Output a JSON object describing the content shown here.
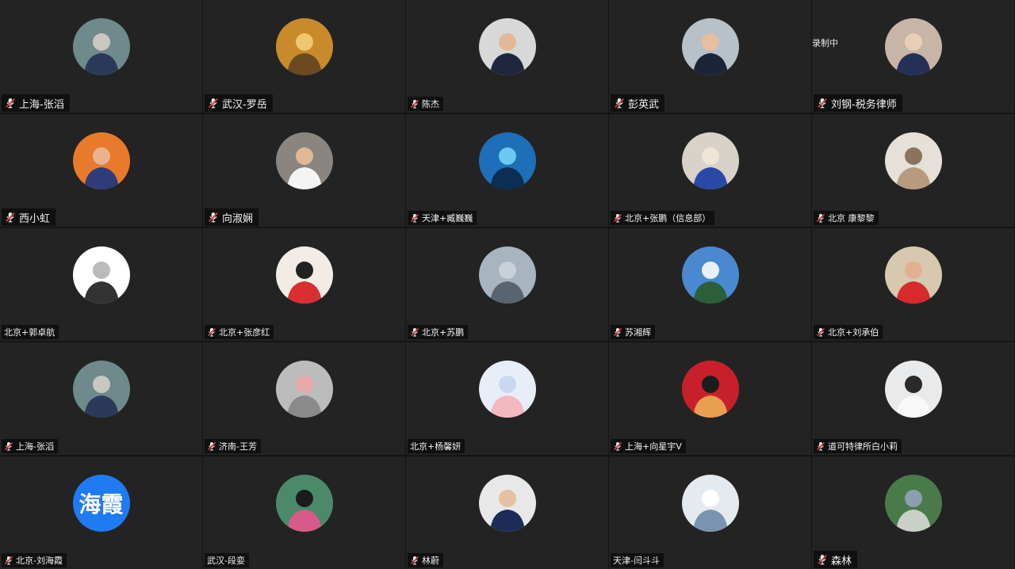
{
  "colors": {
    "tile_bg": "#232323",
    "mic_red": "#d93b3b",
    "text_avatar_bg": "#1f7bf2"
  },
  "overlay_text": "录制中",
  "participants": [
    {
      "name": "上海-张滔",
      "muted": true,
      "avatar": "photo",
      "colors": [
        "#6f8a8c",
        "#2c3a5a",
        "#c9c7bf"
      ]
    },
    {
      "name": "武汉-罗岳",
      "muted": true,
      "avatar": "photo",
      "colors": [
        "#c98a2c",
        "#6b4a22",
        "#f0c66e"
      ]
    },
    {
      "name": "陈杰",
      "muted": true,
      "avatar": "photo",
      "colors": [
        "#d8d8d8",
        "#1f2740",
        "#e3b897"
      ]
    },
    {
      "name": "彭英武",
      "muted": true,
      "avatar": "photo",
      "colors": [
        "#b8c0c8",
        "#1c2438",
        "#e6bf9f"
      ]
    },
    {
      "name": "刘钢-税务律师",
      "muted": true,
      "avatar": "photo",
      "colors": [
        "#c9b4a8",
        "#243058",
        "#e8d0b8"
      ]
    },
    {
      "name": "西小虹",
      "muted": true,
      "avatar": "photo",
      "colors": [
        "#e87a2c",
        "#2e3d7a",
        "#e8b48f"
      ]
    },
    {
      "name": "向淑娴",
      "muted": true,
      "avatar": "photo",
      "colors": [
        "#8a8580",
        "#f4f4f4",
        "#e0b898"
      ]
    },
    {
      "name": "天津+臧巍巍",
      "muted": true,
      "avatar": "photo",
      "colors": [
        "#1e6fb8",
        "#0c2e55",
        "#6cc8f0"
      ]
    },
    {
      "name": "北京+张鹏（信息部）",
      "muted": true,
      "avatar": "photo",
      "colors": [
        "#d8d2c8",
        "#2a48a8",
        "#f0e6d8"
      ]
    },
    {
      "name": "北京 康黎黎",
      "muted": true,
      "avatar": "photo",
      "colors": [
        "#e6e0d8",
        "#b89a80",
        "#8a7460"
      ]
    },
    {
      "name": "北京+郭卓航",
      "muted": false,
      "avatar": "photo",
      "colors": [
        "#ffffff",
        "#333333",
        "#bbbbbb"
      ]
    },
    {
      "name": "北京+张彦红",
      "muted": true,
      "avatar": "photo",
      "colors": [
        "#f2ece4",
        "#d83030",
        "#222222"
      ]
    },
    {
      "name": "北京+苏鹏",
      "muted": true,
      "avatar": "photo",
      "colors": [
        "#a8b4c0",
        "#5a6470",
        "#c8d0d8"
      ]
    },
    {
      "name": "苏湘辉",
      "muted": true,
      "avatar": "photo",
      "colors": [
        "#4a88d0",
        "#2c5e3a",
        "#e8f0f8"
      ]
    },
    {
      "name": "北京+刘承伯",
      "muted": true,
      "avatar": "photo",
      "colors": [
        "#d8c8b0",
        "#d82a2a",
        "#e0b090"
      ]
    },
    {
      "name": "上海-张滔",
      "muted": true,
      "avatar": "photo",
      "colors": [
        "#6f8a8c",
        "#2c3a5a",
        "#c9c7bf"
      ]
    },
    {
      "name": "济南-王芳",
      "muted": true,
      "avatar": "photo",
      "colors": [
        "#bcbcbc",
        "#8a8a8a",
        "#e6a8a8"
      ]
    },
    {
      "name": "北京+杨馨妍",
      "muted": false,
      "avatar": "photo",
      "colors": [
        "#e8eef8",
        "#f4b8c0",
        "#c8d8f0"
      ]
    },
    {
      "name": "上海+向星宇V",
      "muted": true,
      "avatar": "photo",
      "colors": [
        "#c8202a",
        "#e8a050",
        "#1c1c1c"
      ]
    },
    {
      "name": "道可特律所白小莉",
      "muted": true,
      "avatar": "photo",
      "colors": [
        "#e8eaec",
        "#f8f8f8",
        "#2a2a2a"
      ]
    },
    {
      "name": "北京-刘海霞",
      "muted": true,
      "avatar": "text",
      "avatar_text": "海霞",
      "colors": [
        "#1f7bf2"
      ]
    },
    {
      "name": "武汉-段娈",
      "muted": false,
      "avatar": "photo",
      "colors": [
        "#4a8a6a",
        "#d85a8a",
        "#1c1c1c"
      ]
    },
    {
      "name": "林蔚",
      "muted": true,
      "avatar": "photo",
      "colors": [
        "#e8e8e8",
        "#1c2c58",
        "#e6c0a0"
      ]
    },
    {
      "name": "天津-闫斗斗",
      "muted": false,
      "avatar": "photo",
      "colors": [
        "#e4eaf0",
        "#7a94b0",
        "#ffffff"
      ]
    },
    {
      "name": "森林",
      "muted": true,
      "avatar": "photo",
      "colors": [
        "#4a7a4a",
        "#c8d0c8",
        "#8aa0b0"
      ]
    }
  ]
}
